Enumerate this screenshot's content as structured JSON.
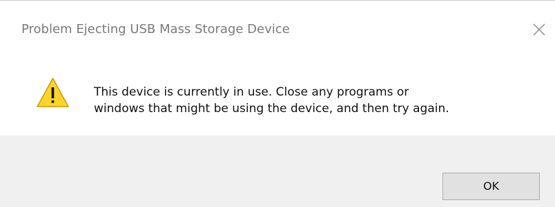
{
  "dialog": {
    "title": "Problem Ejecting USB Mass Storage Device",
    "close_icon": "close-icon",
    "warning_icon": "warning-icon",
    "message_line_1": "This device is currently in use. Close any programs or",
    "message_line_2": "windows that might be using the device, and then try again.",
    "ok_label": "OK"
  },
  "colors": {
    "title_text": "#7a7a7a",
    "footer_background": "#f0f0f0",
    "button_background": "#e1e1e1",
    "warning_yellow": "#ffd42a"
  }
}
